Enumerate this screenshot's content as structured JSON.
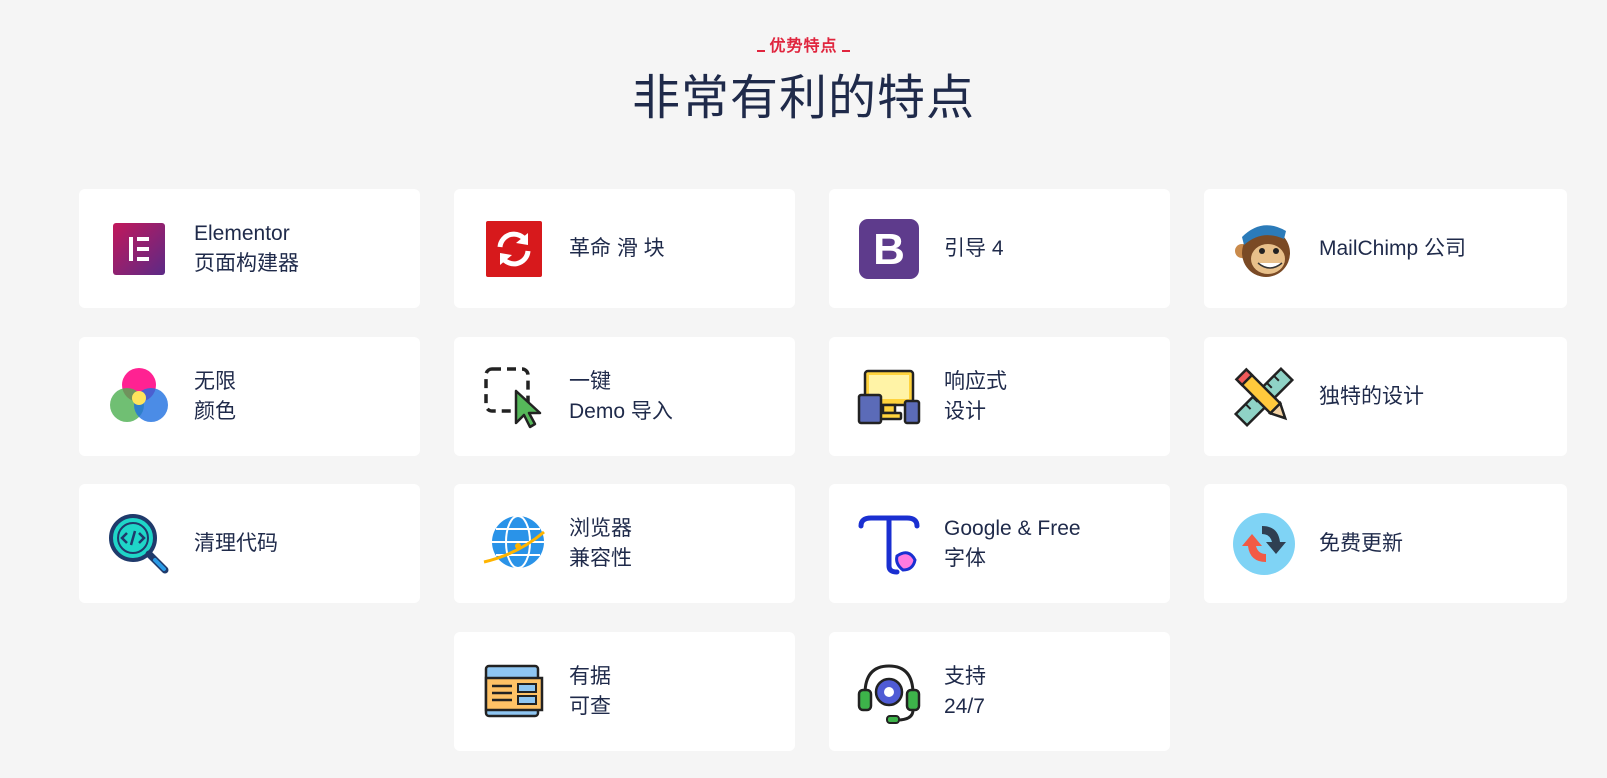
{
  "header": {
    "eyebrow": "优势特点",
    "title": "非常有利的特点"
  },
  "features": [
    {
      "line1": "Elementor",
      "line2": "页面构建器",
      "icon": "elementor-icon"
    },
    {
      "line1": "革命 滑 块",
      "line2": "",
      "icon": "revolution-slider-icon"
    },
    {
      "line1": "引导 4",
      "line2": "",
      "icon": "bootstrap-icon"
    },
    {
      "line1": "MailChimp 公司",
      "line2": "",
      "icon": "mailchimp-icon"
    },
    {
      "line1": "无限",
      "line2": "颜色",
      "icon": "color-circles-icon"
    },
    {
      "line1": "一键",
      "line2": "Demo 导入",
      "icon": "one-click-cursor-icon"
    },
    {
      "line1": "响应式",
      "line2": "设计",
      "icon": "responsive-devices-icon"
    },
    {
      "line1": "独特的设计",
      "line2": "",
      "icon": "pencil-ruler-icon"
    },
    {
      "line1": "清理代码",
      "line2": "",
      "icon": "code-magnifier-icon"
    },
    {
      "line1": "浏览器",
      "line2": "兼容性",
      "icon": "globe-icon"
    },
    {
      "line1": "Google & Free",
      "line2": "字体",
      "icon": "font-t-icon"
    },
    {
      "line1": "免费更新",
      "line2": "",
      "icon": "update-arrows-icon"
    },
    {
      "line1": "有据",
      "line2": "可查",
      "icon": "documentation-icon"
    },
    {
      "line1": "支持",
      "line2": "24/7",
      "icon": "support-headset-icon"
    }
  ]
}
